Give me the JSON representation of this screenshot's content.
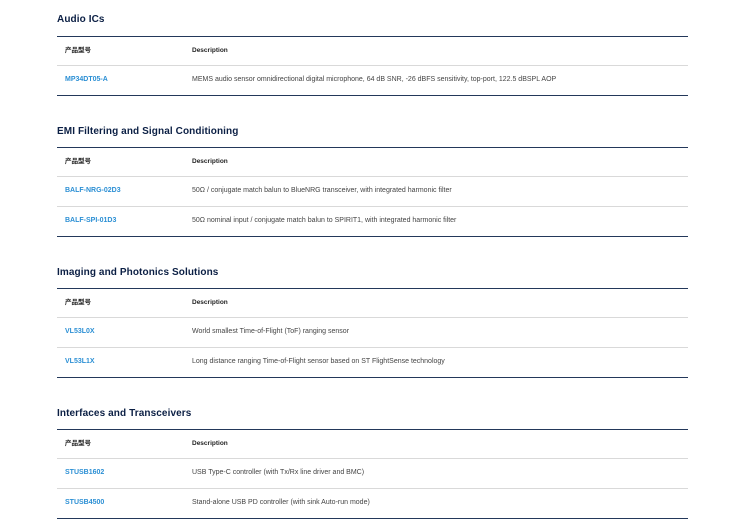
{
  "columns": {
    "part": "产品型号",
    "desc": "Description"
  },
  "sections": [
    {
      "title": "Audio ICs",
      "rows": [
        {
          "part": "MP34DT05-A",
          "desc": "MEMS audio sensor omnidirectional digital microphone, 64 dB SNR, -26 dBFS sensitivity, top-port, 122.5 dBSPL AOP"
        }
      ]
    },
    {
      "title": "EMI Filtering and Signal Conditioning",
      "rows": [
        {
          "part": "BALF-NRG-02D3",
          "desc": "50Ω / conjugate match balun to BlueNRG transceiver, with integrated harmonic filter"
        },
        {
          "part": "BALF-SPI-01D3",
          "desc": "50Ω nominal input / conjugate match balun to SPIRIT1, with integrated harmonic filter"
        }
      ]
    },
    {
      "title": "Imaging and Photonics Solutions",
      "rows": [
        {
          "part": "VL53L0X",
          "desc": "World smallest Time-of-Flight (ToF) ranging sensor"
        },
        {
          "part": "VL53L1X",
          "desc": "Long distance ranging Time-of-Flight sensor based on ST FlightSense technology"
        }
      ]
    },
    {
      "title": "Interfaces and Transceivers",
      "rows": [
        {
          "part": "STUSB1602",
          "desc": "USB Type-C controller (with Tx/Rx line driver and BMC)"
        },
        {
          "part": "STUSB4500",
          "desc": "Stand-alone USB PD controller (with sink Auto-run mode)"
        }
      ]
    }
  ]
}
